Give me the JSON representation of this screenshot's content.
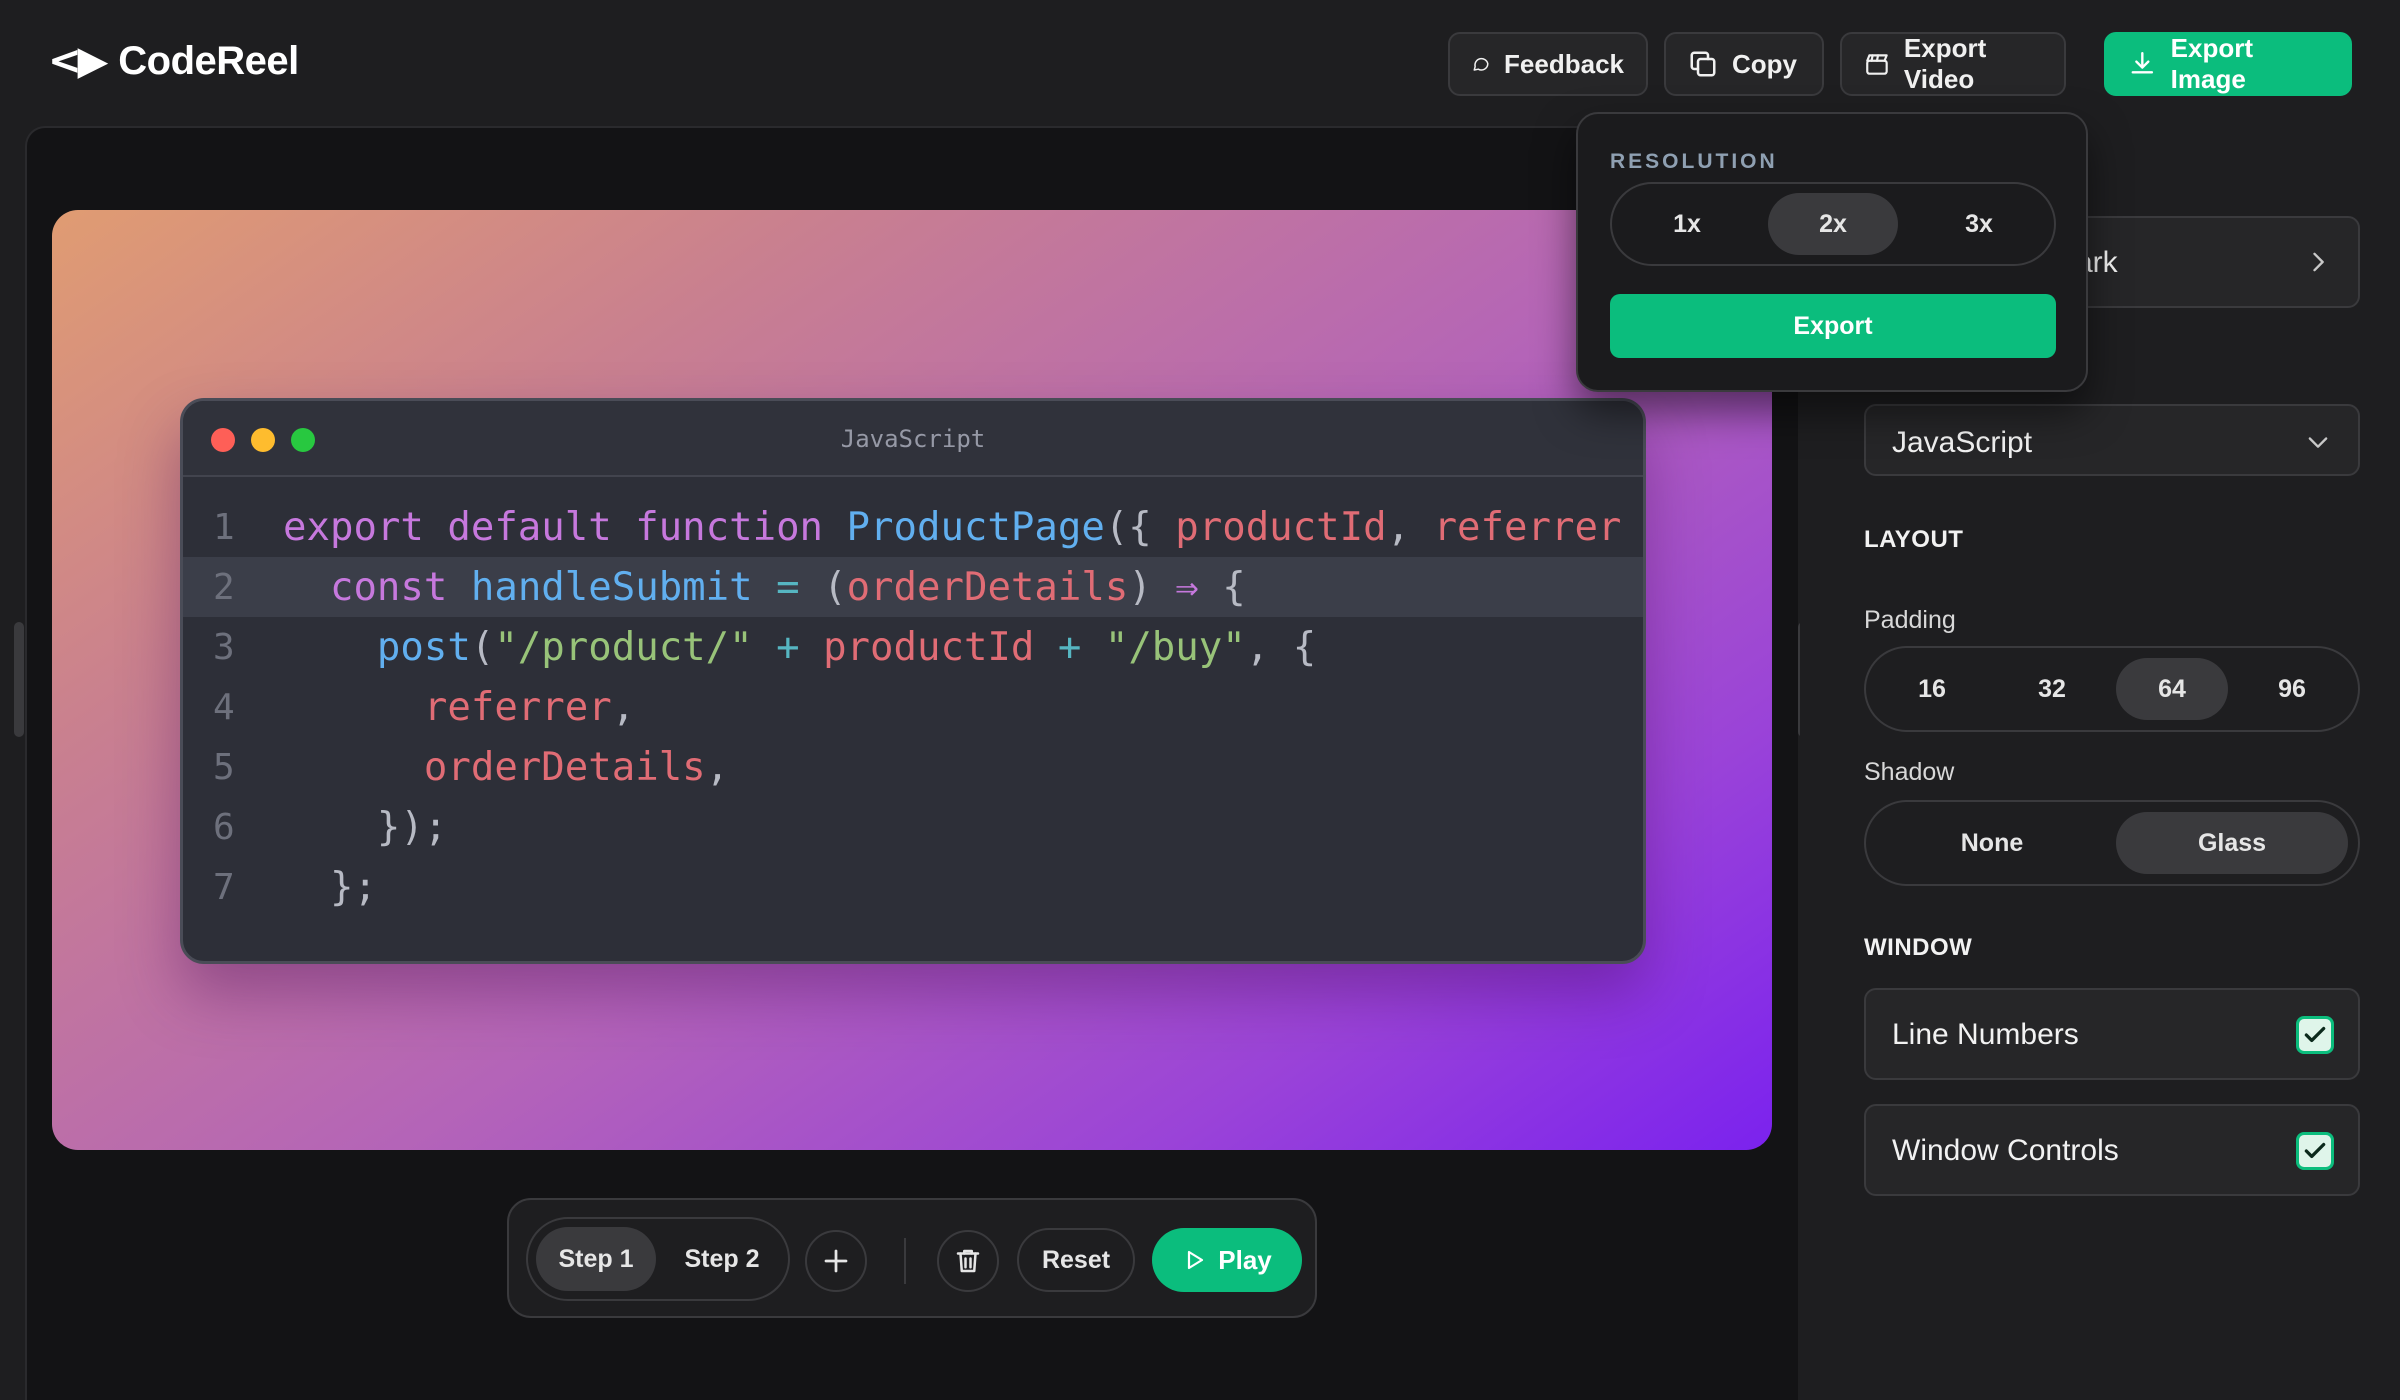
{
  "app": {
    "name": "CodeReel",
    "logo_glyph": "<▶"
  },
  "header": {
    "feedback_label": "Feedback",
    "copy_label": "Copy",
    "export_video_label": "Export Video",
    "export_image_label": "Export Image"
  },
  "code_window": {
    "title": "JavaScript",
    "highlighted_line": 2,
    "lines": [
      {
        "n": "1",
        "tokens": [
          [
            "kw",
            "export default function "
          ],
          [
            "fn",
            "ProductPage"
          ],
          [
            "pu",
            "({ "
          ],
          [
            "pm",
            "productId"
          ],
          [
            "pu",
            ", "
          ],
          [
            "pm",
            "referrer"
          ]
        ]
      },
      {
        "n": "2",
        "tokens": [
          [
            "pu",
            "  "
          ],
          [
            "kw",
            "const "
          ],
          [
            "fn",
            "handleSubmit "
          ],
          [
            "op",
            "= "
          ],
          [
            "pu",
            "("
          ],
          [
            "pm",
            "orderDetails"
          ],
          [
            "pu",
            ") "
          ],
          [
            "kw",
            "⇒ "
          ],
          [
            "pu",
            "{"
          ]
        ]
      },
      {
        "n": "3",
        "tokens": [
          [
            "pu",
            "    "
          ],
          [
            "fn",
            "post"
          ],
          [
            "pu",
            "("
          ],
          [
            "st",
            "\"/product/\" "
          ],
          [
            "op",
            "+ "
          ],
          [
            "pm",
            "productId "
          ],
          [
            "op",
            "+ "
          ],
          [
            "st",
            "\"/buy\""
          ],
          [
            "pu",
            ", {"
          ]
        ]
      },
      {
        "n": "4",
        "tokens": [
          [
            "pu",
            "      "
          ],
          [
            "pm",
            "referrer"
          ],
          [
            "pu",
            ","
          ]
        ]
      },
      {
        "n": "5",
        "tokens": [
          [
            "pu",
            "      "
          ],
          [
            "pm",
            "orderDetails"
          ],
          [
            "pu",
            ","
          ]
        ]
      },
      {
        "n": "6",
        "tokens": [
          [
            "pu",
            "    });"
          ]
        ]
      },
      {
        "n": "7",
        "tokens": [
          [
            "pu",
            "  };"
          ]
        ]
      }
    ]
  },
  "toolbar": {
    "step1_label": "Step 1",
    "step2_label": "Step 2",
    "reset_label": "Reset",
    "play_label": "Play"
  },
  "popover": {
    "title": "RESOLUTION",
    "options": [
      "1x",
      "2x",
      "3x"
    ],
    "selected": "2x",
    "export_label": "Export"
  },
  "panel": {
    "theme_label": "ark",
    "language_label": "JavaScript",
    "layout_title": "LAYOUT",
    "padding_label": "Padding",
    "padding_options": [
      "16",
      "32",
      "64",
      "96"
    ],
    "padding_selected": "64",
    "shadow_label": "Shadow",
    "shadow_options": [
      "None",
      "Glass"
    ],
    "shadow_selected": "Glass",
    "window_title": "WINDOW",
    "line_numbers_label": "Line Numbers",
    "line_numbers_checked": true,
    "window_controls_label": "Window Controls",
    "window_controls_checked": true
  },
  "colors": {
    "accent": "#0bbd7d",
    "background": "#1e1e20",
    "code_bg": "#2d2f38"
  }
}
